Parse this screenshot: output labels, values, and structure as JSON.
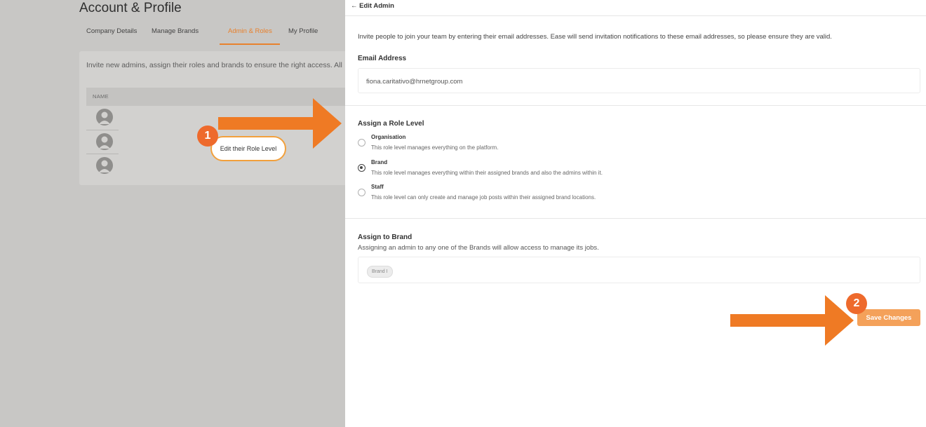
{
  "page": {
    "title": "Account & Profile",
    "tabs": [
      {
        "label": "Company Details",
        "active": false
      },
      {
        "label": "Manage Brands",
        "active": false
      },
      {
        "label": "Admin & Roles",
        "active": true
      },
      {
        "label": "My Profile",
        "active": false
      }
    ],
    "card_text": "Invite new admins, assign their roles and brands to ensure the right access. All",
    "table_header": "NAME"
  },
  "annotations": {
    "callout_text": "Edit their Role Level",
    "badge1": "1",
    "badge2": "2"
  },
  "panel": {
    "back_icon": "←",
    "back_label": "Edit Admin",
    "intro": "Invite people to join your team by entering their email addresses. Ease will send invitation notifications to these email addresses, so please ensure they are valid.",
    "email_label": "Email Address",
    "email_value": "fiona.caritativo@hrnetgroup.com",
    "role_heading": "Assign a Role Level",
    "roles": [
      {
        "title": "Organisation",
        "desc": "This role level manages everything on the platform.",
        "selected": false
      },
      {
        "title": "Brand",
        "desc": "This role level manages everything within their assigned brands and also the admins within it.",
        "selected": true
      },
      {
        "title": "Staff",
        "desc": "This role level can only create and manage job posts within their assigned brand locations.",
        "selected": false
      }
    ],
    "brand_heading": "Assign to Brand",
    "brand_desc": "Assigning an admin to any one of the Brands will allow access to manage its jobs.",
    "brand_chip": "Brand I",
    "save_label": "Save Changes"
  },
  "colors": {
    "accent": "#e8812d",
    "arrow": "#ef7a24",
    "badge": "#ee6a2c",
    "save_button": "#f4a15a"
  }
}
